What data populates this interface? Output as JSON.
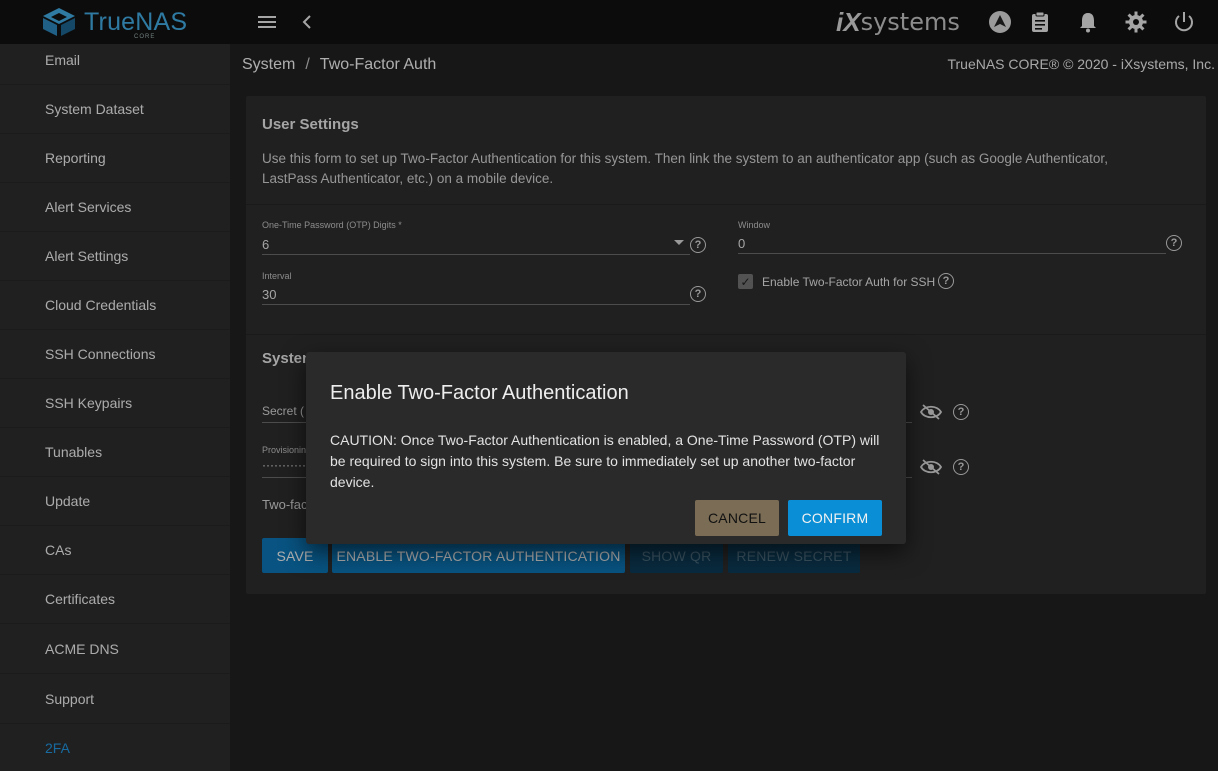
{
  "topbar": {
    "brand_name": "TrueNAS",
    "brand_edition": "CORE",
    "vendor_ix": "iX",
    "vendor_systems": "systems"
  },
  "sidebar": {
    "items": [
      {
        "label": "Email"
      },
      {
        "label": "System Dataset"
      },
      {
        "label": "Reporting"
      },
      {
        "label": "Alert Services"
      },
      {
        "label": "Alert Settings"
      },
      {
        "label": "Cloud Credentials"
      },
      {
        "label": "SSH Connections"
      },
      {
        "label": "SSH Keypairs"
      },
      {
        "label": "Tunables"
      },
      {
        "label": "Update"
      },
      {
        "label": "CAs"
      },
      {
        "label": "Certificates"
      },
      {
        "label": "ACME DNS"
      },
      {
        "label": "Support"
      },
      {
        "label": "2FA"
      }
    ],
    "active_index": 14
  },
  "breadcrumb": {
    "root": "System",
    "separator": "/",
    "current": "Two-Factor Auth"
  },
  "copyright": "TrueNAS CORE® © 2020 - iXsystems, Inc.",
  "user_settings": {
    "title": "User Settings",
    "description": "Use this form to set up Two-Factor Authentication for this system. Then link the system to an authenticator app (such as Google Authenticator, LastPass Authenticator, etc.) on a mobile device.",
    "otp_digits_label": "One-Time Password (OTP) Digits *",
    "otp_digits_value": "6",
    "window_label": "Window",
    "window_value": "0",
    "interval_label": "Interval",
    "interval_value": "30",
    "ssh_label": "Enable Two-Factor Auth for SSH",
    "ssh_checked": true
  },
  "system_settings": {
    "title_partial": "Systen",
    "secret_label_partial": "Secret (",
    "provisioning_label_partial": "Provisionin",
    "provisioning_value_partial": "············",
    "twofactor_text_partial": "Two-fac"
  },
  "actions": {
    "save": "SAVE",
    "enable": "ENABLE TWO-FACTOR AUTHENTICATION",
    "show_qr": "SHOW QR",
    "renew_secret": "RENEW SECRET"
  },
  "dialog": {
    "title": "Enable Two-Factor Authentication",
    "body": "CAUTION: Once Two-Factor Authentication is enabled, a One-Time Password (OTP) will be required to sign into this system. Be sure to immediately set up another two-factor device.",
    "cancel": "CANCEL",
    "confirm": "CONFIRM"
  },
  "colors": {
    "accent": "#0a8fd6",
    "cancel": "#7a6c55",
    "sidebar_active": "#1f8fd6"
  }
}
